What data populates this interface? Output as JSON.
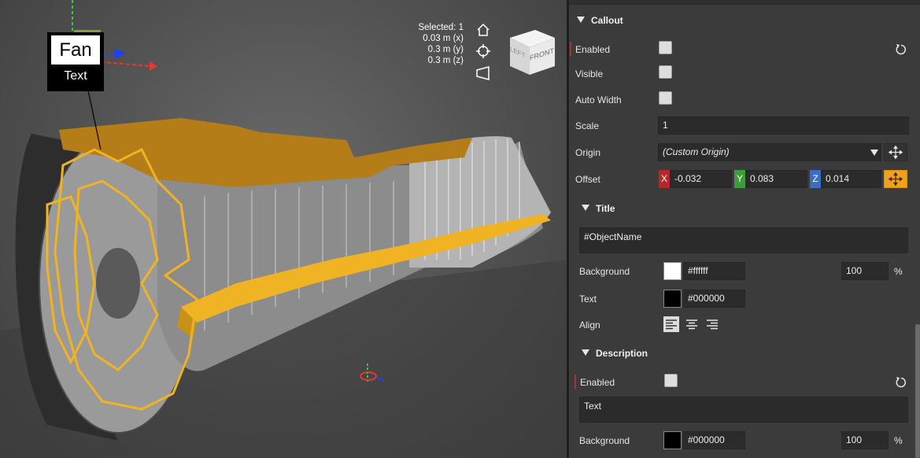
{
  "viewport": {
    "selection": {
      "selected": "Selected: 1",
      "x": "0.03 m (x)",
      "y": "0.3 m (y)",
      "z": "0.3 m (z)"
    },
    "nav_cube": {
      "left": "LEFT",
      "front": "FRONT"
    },
    "callout": {
      "title": "Fan",
      "description": "Text"
    },
    "icons": [
      "home-icon",
      "focus-target-icon",
      "perspective-icon"
    ],
    "highlight_color": "#f0b323"
  },
  "panel": {
    "callout": {
      "header": "Callout",
      "enabled_label": "Enabled",
      "visible_label": "Visible",
      "auto_width_label": "Auto Width",
      "scale_label": "Scale",
      "scale_value": "1",
      "origin_label": "Origin",
      "origin_value": "(Custom Origin)",
      "offset_label": "Offset",
      "offset": {
        "x_tag": "X",
        "x": "-0.032",
        "y_tag": "Y",
        "y": "0.083",
        "z_tag": "Z",
        "z": "0.014"
      }
    },
    "title": {
      "header": "Title",
      "text_value": "#ObjectName",
      "background_label": "Background",
      "background_hex": "#ffffff",
      "background_opacity": "100",
      "percent_sign": "%",
      "text_label": "Text",
      "text_hex": "#000000",
      "align_label": "Align",
      "align_selected": "left"
    },
    "description": {
      "header": "Description",
      "enabled_label": "Enabled",
      "text_value": "Text",
      "background_label": "Background",
      "background_hex": "#000000",
      "background_opacity": "100",
      "percent_sign": "%"
    },
    "colors": {
      "accent": "#f0a020",
      "x_axis": "#b5282a",
      "y_axis": "#3e9a3a",
      "z_axis": "#3a6ec4"
    }
  }
}
